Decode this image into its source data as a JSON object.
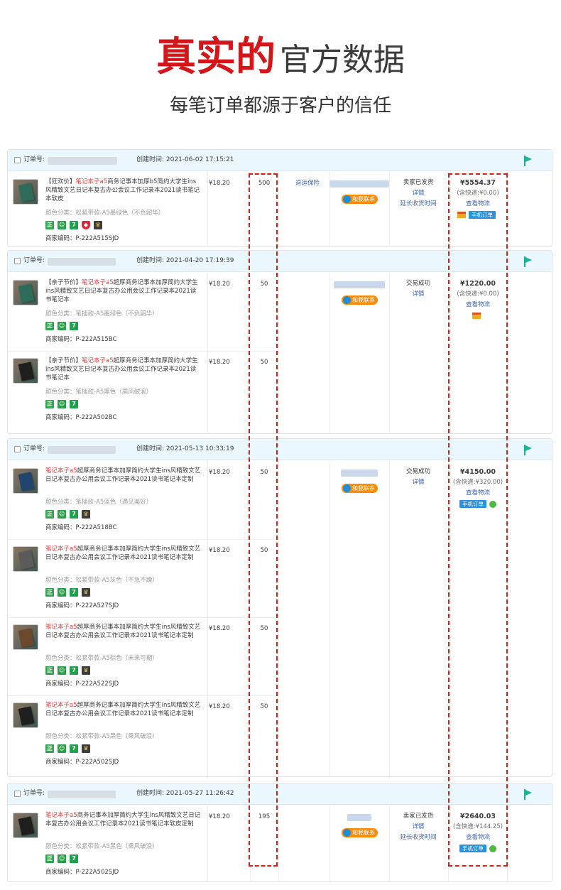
{
  "hero": {
    "title_red": "真实的",
    "title_gray": "官方数据",
    "subtitle": "每笔订单都源于客户的信任"
  },
  "labels": {
    "order_no": "订单号:",
    "created": "创建时间:",
    "insurance": "退运保险",
    "contact": "和我联系",
    "view_logistics": "查看物流",
    "mobile_order": "手机订单"
  },
  "colors": {
    "header_bg": "#eaf8fe",
    "accent_red": "#e4393c",
    "link_blue": "#3c62b6",
    "highlight_dash": "#d91e18"
  },
  "orders": [
    {
      "created": "2021-06-02 17:15:21",
      "total": "¥5554.37",
      "shipping": "(含快递:¥0.00)",
      "status": "卖家已发货",
      "status_links": [
        "详情",
        "延长收货时间"
      ],
      "items": [
        {
          "tag": "【狂欢价】",
          "red": "笔记本子a5",
          "rest": "商务记事本加厚b5简约大学生ins风精致文艺日记本复古办公会议工作记录本2021读书笔记本软皮",
          "spec": "颜色分类：松紧带款-A5墨绿色（不负韶华）",
          "code": "商家编码：P-222A515SJD",
          "price": "¥18.20",
          "qty": "500"
        }
      ]
    },
    {
      "created": "2021-04-20 17:19:39",
      "total": "¥1220.00",
      "shipping": "(含快递:¥0.00)",
      "status": "交易成功",
      "status_links": [
        "详情"
      ],
      "items": [
        {
          "tag": "【亲子节价】",
          "red": "笔记本子a5",
          "rest": "超厚商务记事本加厚简约大学生ins风精致文艺日记本复古办公用会议工作记录本2021读书笔记本",
          "spec": "颜色分类：笔插款-A5墨绿色（不负韶华）",
          "code": "商家编码：P-222A515BC",
          "price": "¥18.20",
          "qty": "50"
        },
        {
          "tag": "【亲子节价】",
          "red": "笔记本子a5",
          "rest": "超厚商务记事本加厚简约大学生ins风精致文艺日记本复古办公用会议工作记录本2021读书笔记本",
          "spec": "颜色分类：笔插款-A5黑色（乘风破浪）",
          "code": "商家编码：P-222A502BC",
          "price": "¥18.20",
          "qty": "50"
        }
      ]
    },
    {
      "created": "2021-05-13 10:33:19",
      "total": "¥4150.00",
      "shipping": "(含快递:¥320.00)",
      "status": "交易成功",
      "status_links": [
        "详情"
      ],
      "items": [
        {
          "tag": "",
          "red": "笔记本子a5",
          "rest": "超厚商务记事本加厚简约大学生ins风精致文艺日记本复古办公用会议工作记录本2021读书笔记本定制",
          "spec": "颜色分类：笔插款-A5蓝色（遇见美好）",
          "code": "商家编码：P-222A518BC",
          "price": "¥18.20",
          "qty": "50"
        },
        {
          "tag": "",
          "red": "笔记本子a5",
          "rest": "超厚商务记事本加厚简约大学生ins风精致文艺日记本复古办公用会议工作记录本2021读书笔记本定制",
          "spec": "颜色分类：松紧带款-A5灰色（不急不躁）",
          "code": "商家编码：P-222A527SJD",
          "price": "¥18.20",
          "qty": "50"
        },
        {
          "tag": "",
          "red": "笔记本子a5",
          "rest": "超厚商务记事本加厚简约大学生ins风精致文艺日记本复古办公用会议工作记录本2021读书笔记本定制",
          "spec": "颜色分类：松紧带款-A5棕色（未来可期）",
          "code": "商家编码：P-222A522SJD",
          "price": "¥18.20",
          "qty": "50"
        },
        {
          "tag": "",
          "red": "笔记本子a5",
          "rest": "超厚商务记事本加厚简约大学生ins风精致文艺日记本复古办公用会议工作记录本2021读书笔记本定制",
          "spec": "颜色分类：松紧带款-A5黑色（乘风破浪）",
          "code": "商家编码：P-222A502SJD",
          "price": "¥18.20",
          "qty": "50"
        }
      ]
    },
    {
      "created": "2021-05-27 11:26:42",
      "total": "¥2640.03",
      "shipping": "(含快递:¥144.25)",
      "status": "卖家已发货",
      "status_links": [
        "详情",
        "延长收货时间"
      ],
      "items": [
        {
          "tag": "",
          "red": "笔记本子a5",
          "rest": "商务记事本加厚简约大学生ins风精致文艺日记本复古办公用会议工作记录本2021读书笔记本软皮定制",
          "spec": "颜色分类：松紧带款-A5黑色（乘风破浪）",
          "code": "商家编码：P-222A502SJD",
          "price": "¥18.20",
          "qty": "195"
        }
      ]
    }
  ]
}
